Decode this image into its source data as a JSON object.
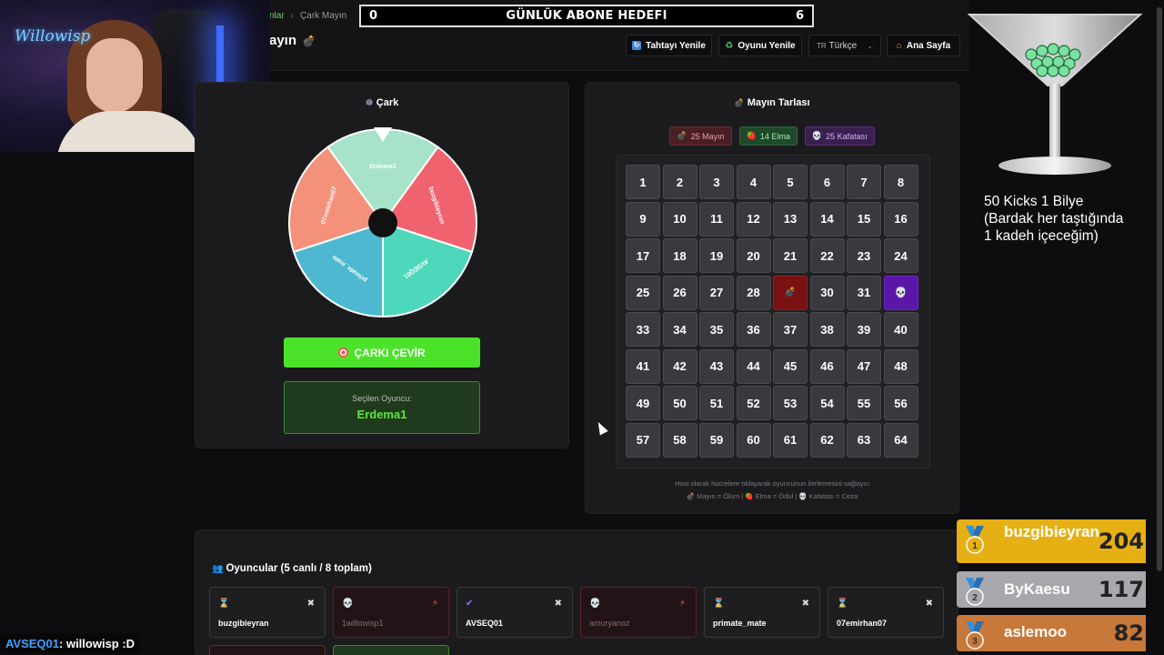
{
  "header": {
    "breadcrumb_prev": "nlar",
    "breadcrumb_current": "Çark Mayın",
    "title": "ayın",
    "buttons": {
      "refresh_board": "Tahtayı Yenile",
      "restart_game": "Oyunu Yenile",
      "language": "Türkçe",
      "language_flag": "TR",
      "home": "Ana Sayfa"
    }
  },
  "goal": {
    "left": "0",
    "title": "GÜNLÜK ABONE HEDEFI",
    "right": "6"
  },
  "webcam": {
    "logo": "Willowisp"
  },
  "wheel": {
    "title": "Çark",
    "segments": [
      {
        "name": "Erdema1",
        "color": "#a6e3c8"
      },
      {
        "name": "buzgibieyran",
        "color": "#f0636e"
      },
      {
        "name": "AVSEQ01",
        "color": "#4dd8bc"
      },
      {
        "name": "primate_mate",
        "color": "#4db8d0"
      },
      {
        "name": "07emirhan07",
        "color": "#f4917a"
      }
    ],
    "spin_button": "ÇARKI ÇEVİR",
    "selected_label": "Seçilen Oyuncu:",
    "selected_value": "Erdema1"
  },
  "minefield": {
    "title": "Mayın Tarlası",
    "badges": {
      "mines": "25 Mayın",
      "apples": "14 Elma",
      "skulls": "25 Kafatası"
    },
    "cells": [
      1,
      2,
      3,
      4,
      5,
      6,
      7,
      8,
      9,
      10,
      11,
      12,
      13,
      14,
      15,
      16,
      17,
      18,
      19,
      20,
      21,
      22,
      23,
      24,
      25,
      26,
      27,
      28,
      "mine",
      30,
      31,
      "skull",
      33,
      34,
      35,
      36,
      37,
      38,
      39,
      40,
      41,
      42,
      43,
      44,
      45,
      46,
      47,
      48,
      49,
      50,
      51,
      52,
      53,
      54,
      55,
      56,
      57,
      58,
      59,
      60,
      61,
      62,
      63,
      64
    ],
    "hint1": "Host olarak hücrelere tıklayarak oyuncunun ilerlemesini sağlayın",
    "hint2": "💣 Mayın = Ölüm | 🍓 Elma = Ödül | 💀 Kafatası = Ceza"
  },
  "players": {
    "title": "Oyuncular (5 canlı / 8 toplam)",
    "list": [
      {
        "name": "buzgibieyran",
        "status": "waiting",
        "dead": false
      },
      {
        "name": "1willowisp1",
        "status": "dead",
        "dead": true
      },
      {
        "name": "AVSEQ01",
        "status": "done",
        "dead": false
      },
      {
        "name": "amuryanoz",
        "status": "dead",
        "dead": true
      },
      {
        "name": "primate_mate",
        "status": "waiting",
        "dead": false
      },
      {
        "name": "07emirhan07",
        "status": "waiting",
        "dead": false
      }
    ]
  },
  "chat": {
    "user": "AVSEQ01",
    "message": " : willowisp :D"
  },
  "overlay": {
    "kicks_line1": "50 Kicks 1 Bilye",
    "kicks_line2": "(Bardak her taştığında",
    "kicks_line3": "1 kadeh içeceğim)"
  },
  "leaderboard": [
    {
      "rank": "1",
      "name": "buzgibieyran",
      "score": "204",
      "color": "#e6b015"
    },
    {
      "rank": "2",
      "name": "ByKaesu",
      "score": "117",
      "color": "#a8a8ac"
    },
    {
      "rank": "3",
      "name": "aslemoo",
      "score": "82",
      "color": "#c87838"
    }
  ]
}
